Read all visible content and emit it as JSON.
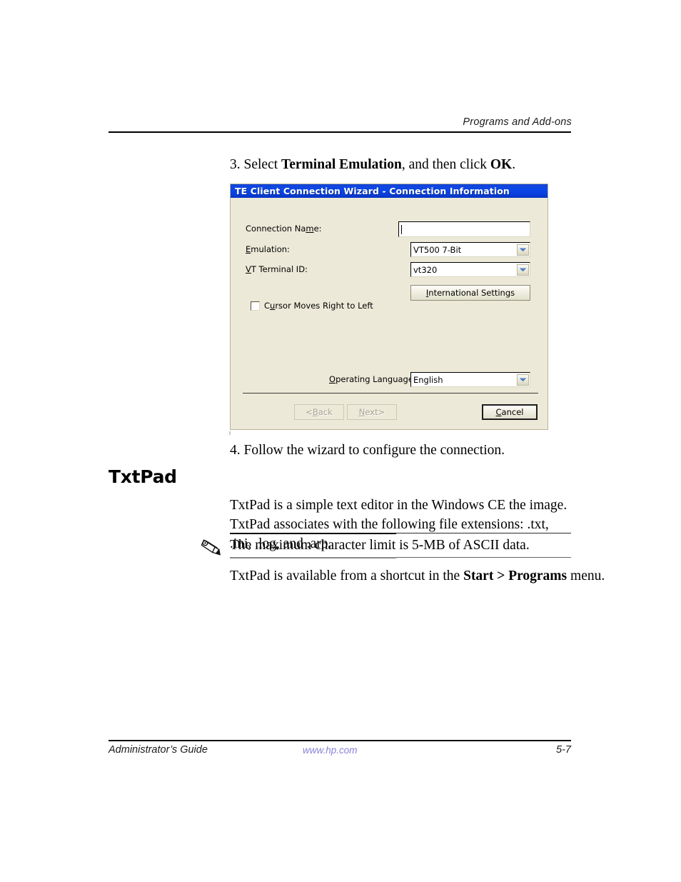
{
  "page": {
    "running_header": "Programs and Add-ons",
    "section_heading": "TxtPad"
  },
  "steps": {
    "step3_prefix": "3. Select ",
    "step3_bold1": "Terminal Emulation",
    "step3_middle": ", and then click ",
    "step3_bold2": "OK",
    "step3_suffix": ".",
    "step4": "4. Follow the wizard to configure the connection."
  },
  "dialog": {
    "title": "TE Client Connection Wizard - Connection Information",
    "fields": {
      "connection_name_label_pre": "Connection Na",
      "connection_name_label_accel": "m",
      "connection_name_label_post": "e:",
      "connection_name_value": "",
      "emulation_label_accel": "E",
      "emulation_label_post": "mulation:",
      "emulation_value": "VT500 7-Bit",
      "vt_terminal_label_accel": "V",
      "vt_terminal_label_post": "T Terminal ID:",
      "vt_terminal_value": "vt320",
      "operating_language_label_accel": "O",
      "operating_language_label_post": "perating Language:",
      "operating_language_value": "English"
    },
    "international_settings_pre": "",
    "international_settings_accel": "I",
    "international_settings_post": "nternational Settings",
    "checkbox": {
      "label_pre": "C",
      "label_accel": "u",
      "label_post": "rsor Moves Right to Left",
      "checked": false
    },
    "buttons": {
      "back_pre": "<",
      "back_accel": "B",
      "back_post": "ack",
      "back_disabled": true,
      "next_accel": "N",
      "next_post": "ext>",
      "next_disabled": true,
      "cancel_accel": "C",
      "cancel_post": "ancel",
      "cancel_default": true
    },
    "colors": {
      "titlebar_blue": "#0a47e8",
      "face": "#ece9d8",
      "field_white": "#ffffff"
    }
  },
  "content": {
    "intro_paragraph": "TxtPad is a simple text editor in the Windows CE the image. TxtPad associates with the following file extensions: .txt, .ini, .log, and .arp.",
    "note_text": "The maximum character limit is 5-MB of ASCII data.",
    "outro_prefix": "TxtPad is available from a shortcut in the ",
    "outro_bold": "Start > Programs",
    "outro_suffix": " menu."
  },
  "footer": {
    "left": "Administrator’s Guide",
    "center": "www.hp.com",
    "right": "5-7",
    "center_color": "#8a82d8"
  }
}
